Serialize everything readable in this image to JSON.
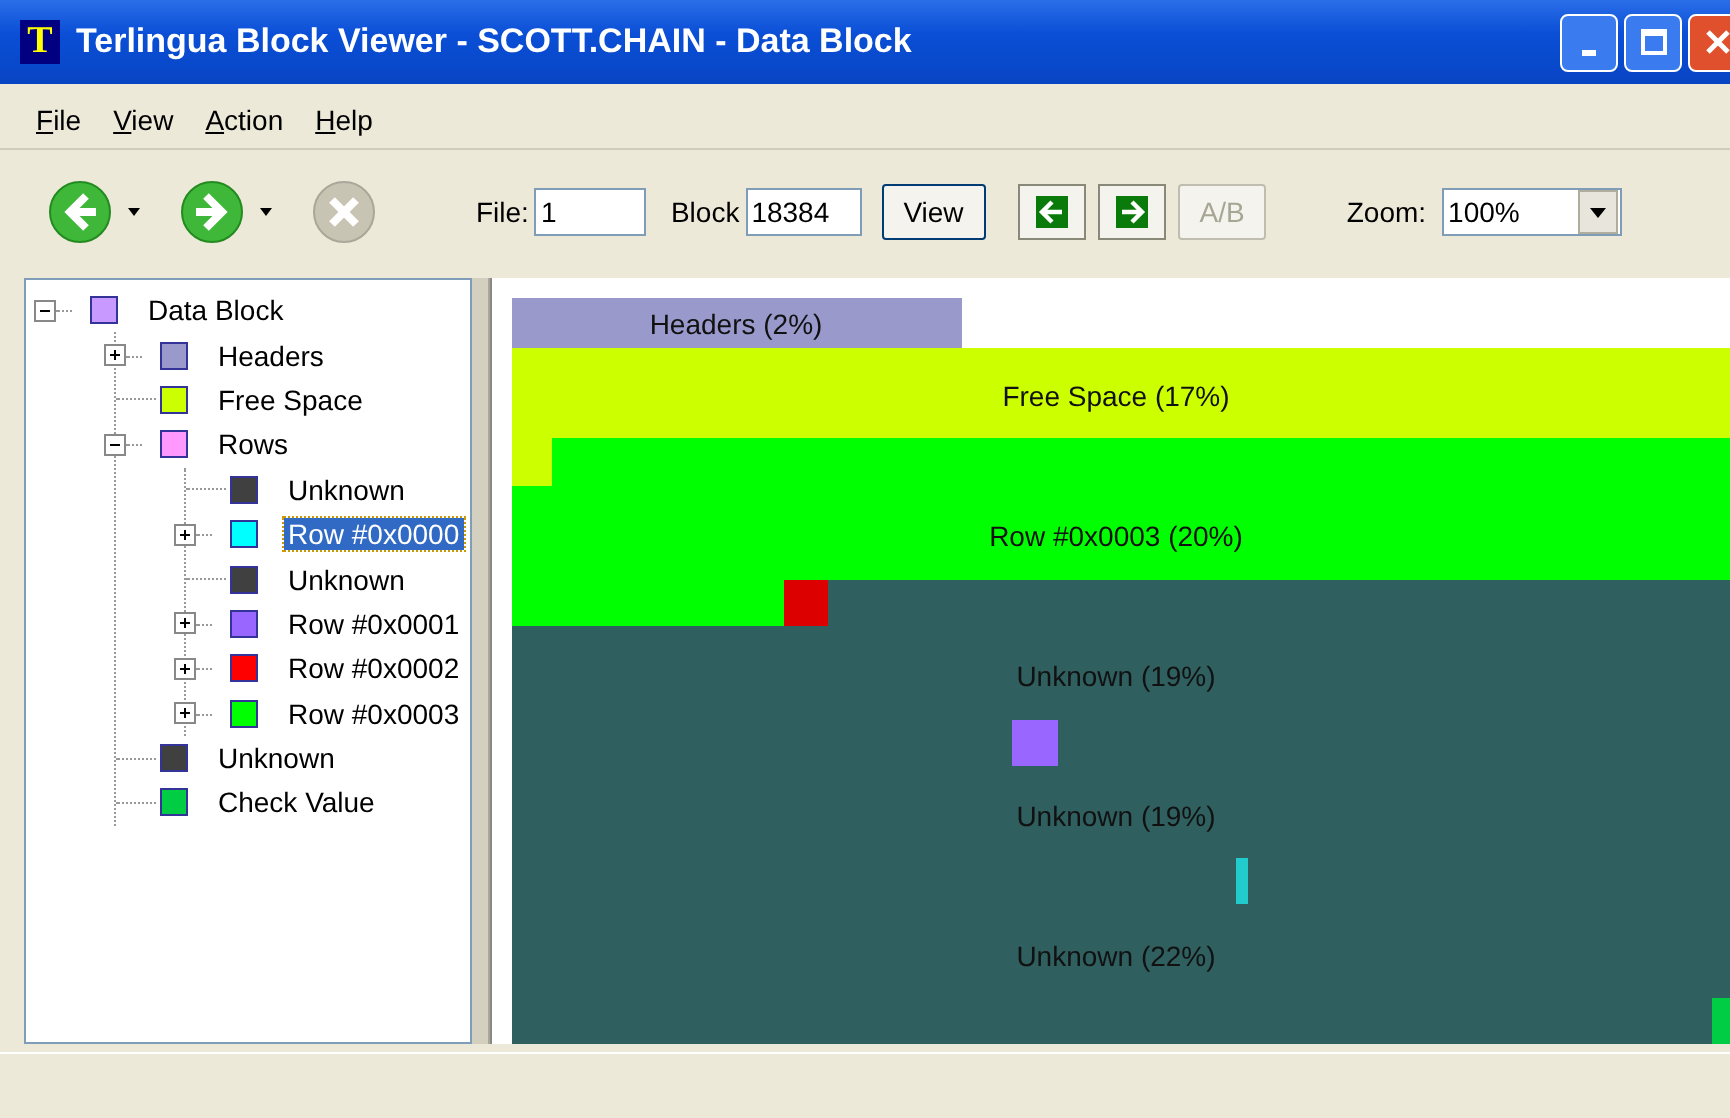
{
  "window": {
    "app_icon": "T",
    "title": "Terlingua Block Viewer - SCOTT.CHAIN - Data Block"
  },
  "menu": [
    "File",
    "View",
    "Action",
    "Help"
  ],
  "toolbar": {
    "nav": [
      {
        "kind": "back",
        "disabled": false
      },
      {
        "kind": "forward",
        "disabled": false
      },
      {
        "kind": "stop",
        "disabled": true
      }
    ],
    "fields": [
      {
        "label": "File:",
        "value": "1"
      },
      {
        "label": "Block",
        "value": "18384"
      }
    ],
    "view_button": "View",
    "steps": [
      {
        "kind": "prev"
      },
      {
        "kind": "next"
      }
    ],
    "ab_button": {
      "label": "A/B",
      "disabled": true
    },
    "zoom": {
      "label": "Zoom:",
      "value": "100%"
    }
  },
  "tree": [
    {
      "label": "Data Block",
      "color": "#c899ff",
      "expanded": true,
      "selected": false,
      "children": [
        {
          "label": "Headers",
          "color": "#9999cc",
          "expanded": false,
          "selected": false
        },
        {
          "label": "Free Space",
          "color": "#ccff00",
          "selected": false
        },
        {
          "label": "Rows",
          "color": "#ff99ff",
          "expanded": true,
          "selected": false,
          "children": [
            {
              "label": "Unknown",
              "color": "#404040",
              "selected": false
            },
            {
              "label": "Row #0x0000",
              "color": "#00ffff",
              "expanded": false,
              "selected": true
            },
            {
              "label": "Unknown",
              "color": "#404040",
              "selected": false
            },
            {
              "label": "Row #0x0001",
              "color": "#9966ff",
              "expanded": false,
              "selected": false
            },
            {
              "label": "Row #0x0002",
              "color": "#ff0000",
              "expanded": false,
              "selected": false
            },
            {
              "label": "Row #0x0003",
              "color": "#00ff00",
              "expanded": false,
              "selected": false
            }
          ]
        },
        {
          "label": "Unknown",
          "color": "#404040",
          "selected": false
        },
        {
          "label": "Check Value",
          "color": "#00cc44",
          "selected": false
        }
      ]
    }
  ],
  "block_map": {
    "labels": [
      "Headers (2%)",
      "Free Space (17%)",
      "Row #0x0003 (20%)",
      "Unknown (19%)",
      "Unknown (19%)",
      "Unknown (22%)"
    ]
  }
}
